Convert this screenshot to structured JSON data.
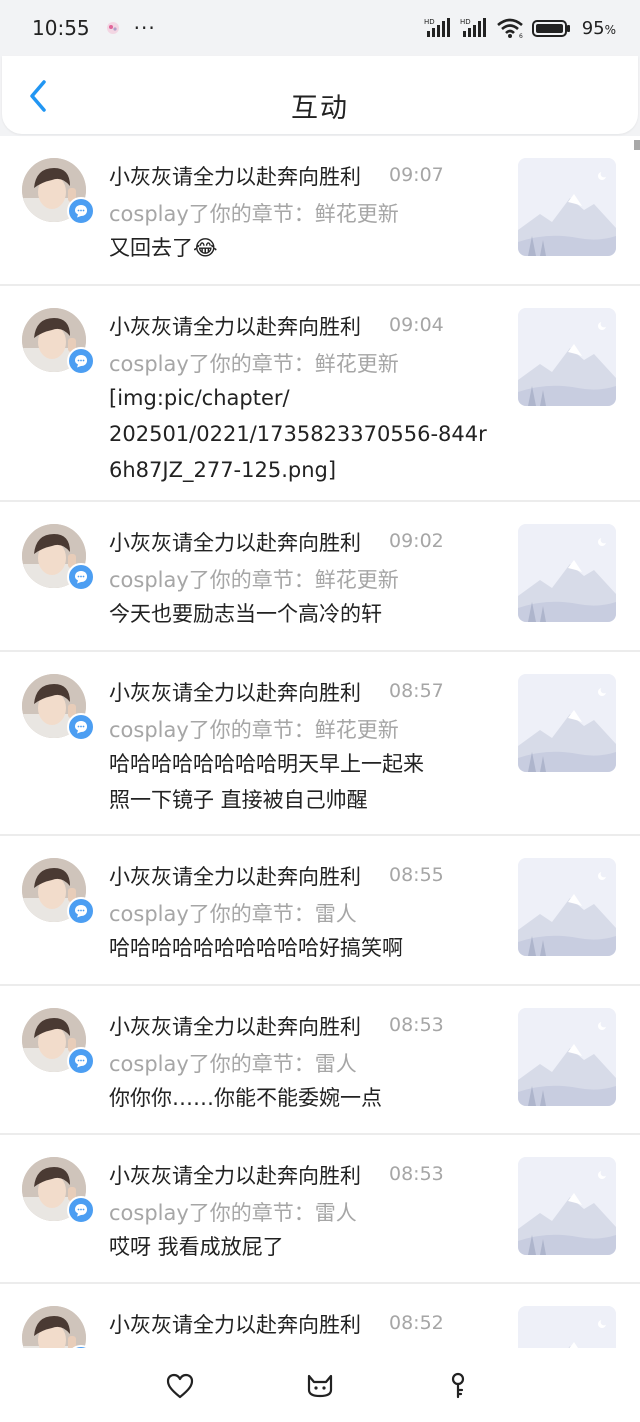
{
  "status": {
    "time": "10:55",
    "dots": "···",
    "battery_percent": "95",
    "battery_unit": "%"
  },
  "header": {
    "title": "互动",
    "back_icon": "chevron-left-icon"
  },
  "colors": {
    "accent": "#2196f3",
    "badge": "#4c9ef2",
    "secondary_text": "#a6a6a6"
  },
  "interactions": [
    {
      "name": "小灰灰请全力以赴奔向胜利",
      "time": "09:07",
      "sub": "cosplay了你的章节：鲜花更新",
      "content": "又回去了😂"
    },
    {
      "name": "小灰灰请全力以赴奔向胜利",
      "time": "09:04",
      "sub": "cosplay了你的章节：鲜花更新",
      "content": "[img:pic/chapter/\n202501/0221/1735823370556-844r\n6h87JZ_277-125.png]"
    },
    {
      "name": "小灰灰请全力以赴奔向胜利",
      "time": "09:02",
      "sub": "cosplay了你的章节：鲜花更新",
      "content": "今天也要励志当一个高冷的轩"
    },
    {
      "name": "小灰灰请全力以赴奔向胜利",
      "time": "08:57",
      "sub": "cosplay了你的章节：鲜花更新",
      "content": "哈哈哈哈哈哈哈哈明天早上一起来\n照一下镜子 直接被自己帅醒"
    },
    {
      "name": "小灰灰请全力以赴奔向胜利",
      "time": "08:55",
      "sub": "cosplay了你的章节：雷人",
      "content": "哈哈哈哈哈哈哈哈哈哈好搞笑啊"
    },
    {
      "name": "小灰灰请全力以赴奔向胜利",
      "time": "08:53",
      "sub": "cosplay了你的章节：雷人",
      "content": "你你你……你能不能委婉一点"
    },
    {
      "name": "小灰灰请全力以赴奔向胜利",
      "time": "08:53",
      "sub": "cosplay了你的章节：雷人",
      "content": "哎呀 我看成放屁了"
    },
    {
      "name": "小灰灰请全力以赴奔向胜利",
      "time": "08:52",
      "sub": "",
      "content": ""
    }
  ],
  "bottom_nav": [
    {
      "icon": "heart-icon"
    },
    {
      "icon": "cat-icon"
    },
    {
      "icon": "key-icon"
    }
  ]
}
